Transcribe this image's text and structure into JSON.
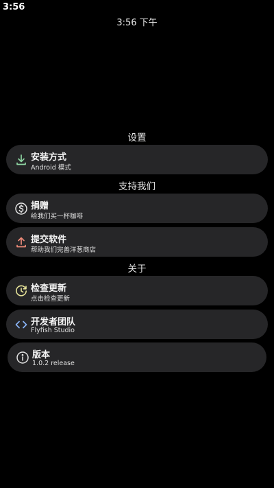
{
  "status_bar": {
    "time": "3:56"
  },
  "header": {
    "clock": "3:56 下午"
  },
  "sections": {
    "settings": {
      "title": "设置",
      "items": [
        {
          "title": "安装方式",
          "subtitle": "Android 模式",
          "icon": "download-icon",
          "icon_color": "#8fd6a3"
        }
      ]
    },
    "support": {
      "title": "支持我们",
      "items": [
        {
          "title": "捐赠",
          "subtitle": "给我们买一杯咖啡",
          "icon": "dollar-icon",
          "icon_color": "#e6e6e6"
        },
        {
          "title": "提交软件",
          "subtitle": "帮助我们完善洋葱商店",
          "icon": "upload-icon",
          "icon_color": "#f08c7a"
        }
      ]
    },
    "about": {
      "title": "关于",
      "items": [
        {
          "title": "检查更新",
          "subtitle": "点击检查更新",
          "icon": "update-icon",
          "icon_color": "#e8e59a"
        },
        {
          "title": "开发者团队",
          "subtitle": "Flyfish Studio",
          "icon": "code-icon",
          "icon_color": "#8ab4f8"
        },
        {
          "title": "版本",
          "subtitle": "1.0.2 release",
          "icon": "info-icon",
          "icon_color": "#e6e6e6"
        }
      ]
    }
  }
}
